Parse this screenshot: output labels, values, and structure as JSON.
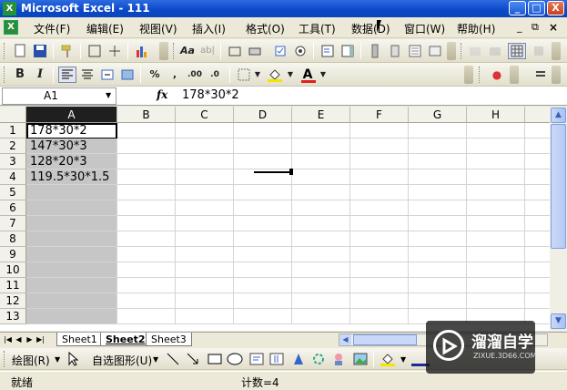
{
  "window": {
    "title": "Microsoft Excel - 111",
    "app_icon": "excel-icon",
    "controls": [
      "_",
      "□",
      "X"
    ]
  },
  "menubar": {
    "items": [
      "文件(F)",
      "编辑(E)",
      "视图(V)",
      "插入(I)",
      "格式(O)",
      "工具(T)",
      "数据(D)",
      "窗口(W)",
      "帮助(H)"
    ],
    "doc_controls": [
      "_",
      "⧉",
      "×"
    ]
  },
  "formula_bar": {
    "name_box": "A1",
    "fx": "fx",
    "formula": "178*30*2"
  },
  "grid": {
    "columns": [
      "A",
      "B",
      "C",
      "D",
      "E",
      "F",
      "G",
      "H"
    ],
    "selected_column": "A",
    "rows": [
      "1",
      "2",
      "3",
      "4",
      "5",
      "6",
      "7",
      "8",
      "9",
      "10",
      "11",
      "12",
      "13"
    ],
    "cells": {
      "A1": "178*30*2",
      "A2": "147*30*3",
      "A3": "128*20*3",
      "A4": "119.5*30*1.5"
    }
  },
  "sheets": {
    "tabs": [
      "Sheet1",
      "Sheet2",
      "Sheet3"
    ],
    "active": "Sheet2"
  },
  "draw_toolbar": {
    "draw_label": "绘图(R)",
    "autoshapes_label": "自选图形(U)"
  },
  "status_bar": {
    "left": "就绪",
    "count": "计数=4"
  },
  "watermark": {
    "text": "溜溜自学",
    "sub": "ZIXUE.3D66.COM"
  },
  "colors": {
    "titlebar": "#0A48C8",
    "selected_column": "#C6C6C6",
    "font_color": "#E02020",
    "fill_color": "#F2E600"
  }
}
